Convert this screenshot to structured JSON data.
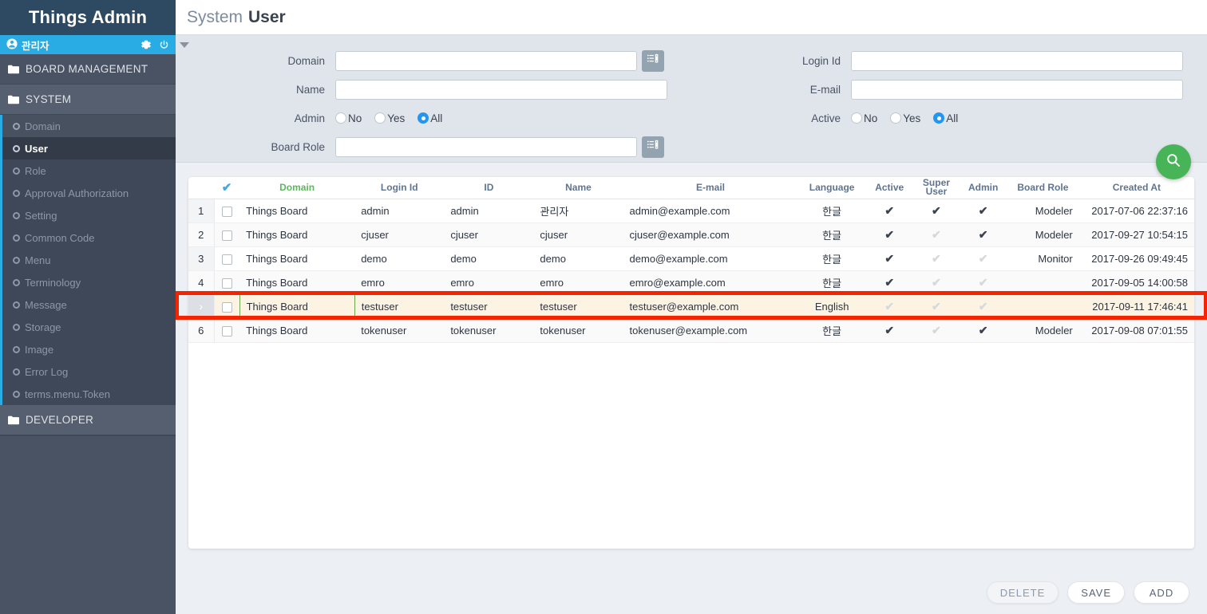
{
  "sidebar": {
    "brand": "Things Admin",
    "user": {
      "name": "관리자",
      "person_icon": "person-icon",
      "settings_icon": "gear-icon",
      "power_icon": "power-icon"
    },
    "groups": [
      {
        "label": "BOARD MANAGEMENT",
        "icon": "folder-icon"
      },
      {
        "label": "SYSTEM",
        "icon": "folder-icon"
      },
      {
        "label": "DEVELOPER",
        "icon": "folder-icon"
      }
    ],
    "system_items": [
      {
        "label": "Domain"
      },
      {
        "label": "User"
      },
      {
        "label": "Role"
      },
      {
        "label": "Approval Authorization"
      },
      {
        "label": "Setting"
      },
      {
        "label": "Common Code"
      },
      {
        "label": "Menu"
      },
      {
        "label": "Terminology"
      },
      {
        "label": "Message"
      },
      {
        "label": "Storage"
      },
      {
        "label": "Image"
      },
      {
        "label": "Error Log"
      },
      {
        "label": "terms.menu.Token"
      }
    ]
  },
  "header": {
    "title_prefix": "System",
    "title_main": "User"
  },
  "search": {
    "collapse_icon": "caret-down-icon",
    "left": {
      "domain_label": "Domain",
      "domain_value": "",
      "domain_placeholder": "",
      "domain_lookup_icon": "list-lookup-icon",
      "name_label": "Name",
      "name_value": "",
      "name_placeholder": "",
      "admin_label": "Admin",
      "admin_options": [
        "No",
        "Yes",
        "All"
      ],
      "admin_selected": "All",
      "board_role_label": "Board Role",
      "board_role_value": "",
      "board_role_placeholder": "",
      "board_role_lookup_icon": "list-lookup-icon"
    },
    "right": {
      "login_id_label": "Login Id",
      "login_id_value": "",
      "login_id_placeholder": "",
      "email_label": "E-mail",
      "email_value": "",
      "email_placeholder": "",
      "active_label": "Active",
      "active_options": [
        "No",
        "Yes",
        "All"
      ],
      "active_selected": "All"
    },
    "search_button_icon": "search-icon",
    "search_button_color": "#47b557"
  },
  "grid": {
    "select_all_icon": "check-icon",
    "columns": [
      {
        "key": "domain",
        "label": "Domain",
        "color": "#5cb85c"
      },
      {
        "key": "login_id",
        "label": "Login Id",
        "color": "#5f7491"
      },
      {
        "key": "id",
        "label": "ID",
        "color": "#5f7491"
      },
      {
        "key": "name",
        "label": "Name",
        "color": "#5f7491"
      },
      {
        "key": "email",
        "label": "E-mail",
        "color": "#5f7491"
      },
      {
        "key": "language",
        "label": "Language",
        "color": "#5f7491"
      },
      {
        "key": "active",
        "label": "Active",
        "color": "#5f7491"
      },
      {
        "key": "super_user",
        "label": "Super User",
        "color": "#5f7491"
      },
      {
        "key": "admin",
        "label": "Admin",
        "color": "#5f7491"
      },
      {
        "key": "board_role",
        "label": "Board Role",
        "color": "#5f7491"
      },
      {
        "key": "created_at",
        "label": "Created At",
        "color": "#5f7491"
      }
    ],
    "rows": [
      {
        "num": "1",
        "checked": false,
        "domain": "Things Board",
        "login_id": "admin",
        "id": "admin",
        "name": "관리자",
        "email": "admin@example.com",
        "language": "한글",
        "active": true,
        "super_user": true,
        "admin": true,
        "board_role": "Modeler",
        "created_at": "2017-07-06 22:37:16",
        "selected": false
      },
      {
        "num": "2",
        "checked": false,
        "domain": "Things Board",
        "login_id": "cjuser",
        "id": "cjuser",
        "name": "cjuser",
        "email": "cjuser@example.com",
        "language": "한글",
        "active": true,
        "super_user": false,
        "admin": true,
        "board_role": "Modeler",
        "created_at": "2017-09-27 10:54:15",
        "selected": false
      },
      {
        "num": "3",
        "checked": false,
        "domain": "Things Board",
        "login_id": "demo",
        "id": "demo",
        "name": "demo",
        "email": "demo@example.com",
        "language": "한글",
        "active": true,
        "super_user": false,
        "admin": false,
        "board_role": "Monitor",
        "created_at": "2017-09-26 09:49:45",
        "selected": false
      },
      {
        "num": "4",
        "checked": false,
        "domain": "Things Board",
        "login_id": "emro",
        "id": "emro",
        "name": "emro",
        "email": "emro@example.com",
        "language": "한글",
        "active": true,
        "super_user": false,
        "admin": false,
        "board_role": "",
        "created_at": "2017-09-05 14:00:58",
        "selected": false
      },
      {
        "num": "›",
        "checked": false,
        "domain": "Things Board",
        "login_id": "testuser",
        "id": "testuser",
        "name": "testuser",
        "email": "testuser@example.com",
        "language": "English",
        "active": false,
        "super_user": false,
        "admin": false,
        "board_role": "",
        "created_at": "2017-09-11 17:46:41",
        "selected": true
      },
      {
        "num": "6",
        "checked": false,
        "domain": "Things Board",
        "login_id": "tokenuser",
        "id": "tokenuser",
        "name": "tokenuser",
        "email": "tokenuser@example.com",
        "language": "한글",
        "active": true,
        "super_user": false,
        "admin": true,
        "board_role": "Modeler",
        "created_at": "2017-09-08 07:01:55",
        "selected": false
      }
    ],
    "highlight_color": "#f42400",
    "focus_cell_border_color": "#6aa84f"
  },
  "footer": {
    "delete_label": "DELETE",
    "save_label": "SAVE",
    "add_label": "ADD"
  }
}
